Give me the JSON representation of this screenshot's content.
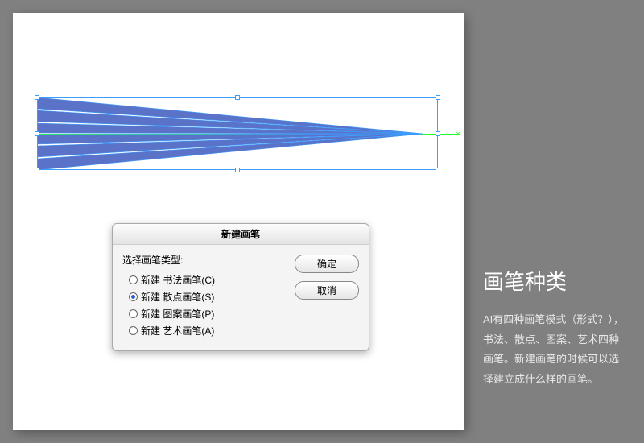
{
  "dialog": {
    "title": "新建画笔",
    "label": "选择画笔类型:",
    "options": [
      {
        "label": "新建 书法画笔(C)",
        "checked": false
      },
      {
        "label": "新建 散点画笔(S)",
        "checked": true
      },
      {
        "label": "新建 图案画笔(P)",
        "checked": false
      },
      {
        "label": "新建 艺术画笔(A)",
        "checked": false
      }
    ],
    "ok": "确定",
    "cancel": "取消"
  },
  "side": {
    "title": "画笔种类",
    "body": "AI有四种画笔模式（形式？），书法、散点、图案、艺术四种画笔。新建画笔的时候可以选择建立成什么样的画笔。"
  }
}
